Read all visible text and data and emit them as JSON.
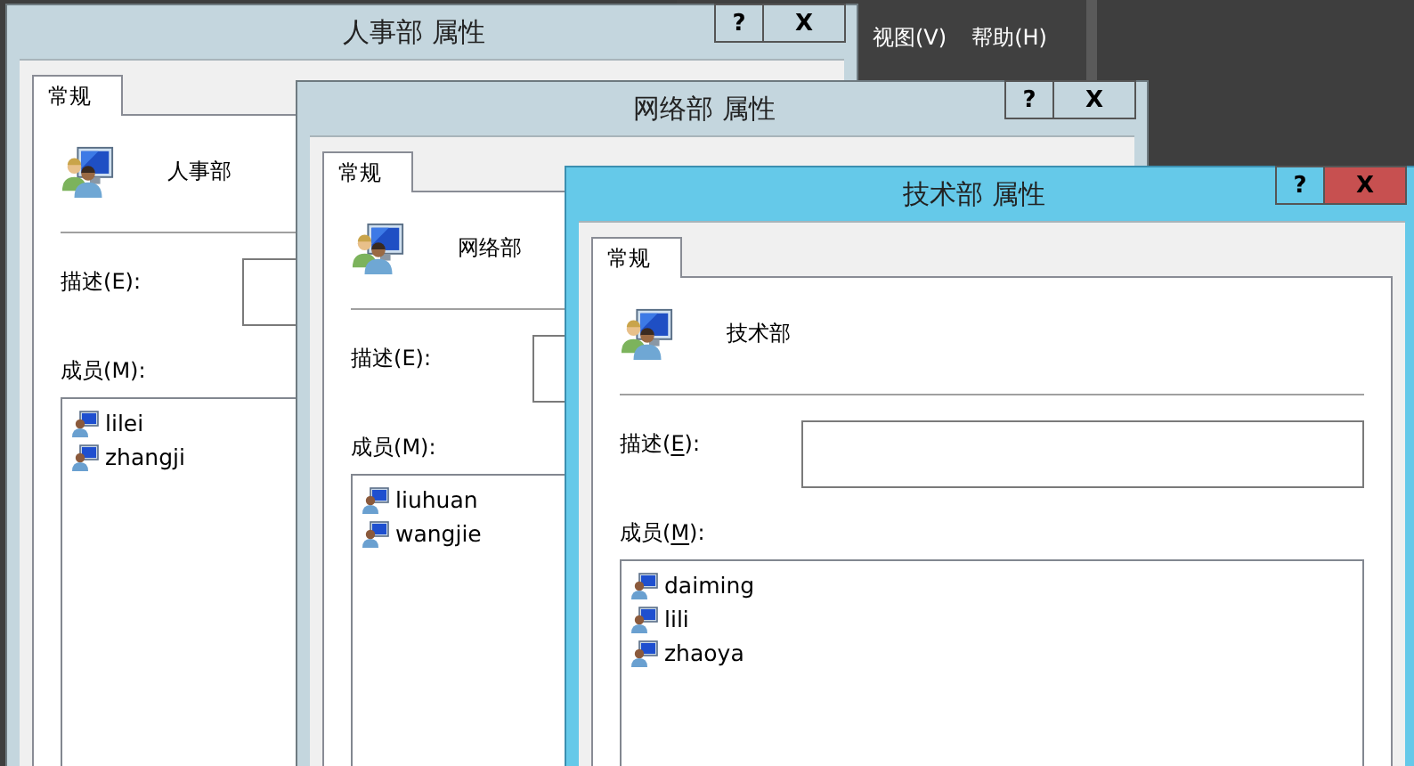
{
  "background_window": {
    "menu": [
      "视图(V)",
      "帮助(H)"
    ]
  },
  "windows": [
    {
      "title": "人事部 属性",
      "active": false,
      "help_button": "?",
      "close_button": "X",
      "tabs": [
        {
          "label": "常规",
          "selected": true
        }
      ],
      "group_name": "人事部",
      "access_keys_shown": false,
      "description_label": [
        "描述(",
        "E",
        "):"
      ],
      "members_label": [
        "成员(",
        "M",
        "):"
      ],
      "members": [
        "lilei",
        "zhangji"
      ]
    },
    {
      "title": "网络部 属性",
      "active": false,
      "help_button": "?",
      "close_button": "X",
      "tabs": [
        {
          "label": "常规",
          "selected": true
        }
      ],
      "group_name": "网络部",
      "access_keys_shown": false,
      "description_label": [
        "描述(",
        "E",
        "):"
      ],
      "members_label": [
        "成员(",
        "M",
        "):"
      ],
      "members": [
        "liuhuan",
        "wangjie"
      ]
    },
    {
      "title": "技术部 属性",
      "active": true,
      "help_button": "?",
      "close_button": "X",
      "tabs": [
        {
          "label": "常规",
          "selected": true
        }
      ],
      "group_name": "技术部",
      "access_keys_shown": true,
      "description_label": [
        "描述(",
        "E",
        "):"
      ],
      "members_label": [
        "成员(",
        "M",
        "):"
      ],
      "members": [
        "daiming",
        "lili",
        "zhaoya"
      ]
    }
  ]
}
